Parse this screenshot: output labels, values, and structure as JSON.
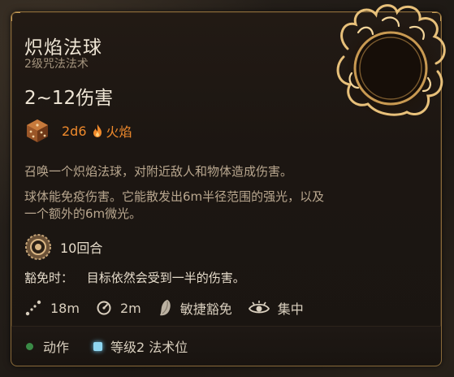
{
  "spell": {
    "title": "炽焰法球",
    "subtitle": "2级咒法法术",
    "damage_total": "2~12伤害",
    "damage_dice": "2d6",
    "damage_type": "火焰",
    "description_1": "召唤一个炽焰法球，对附近敌人和物体造成伤害。",
    "description_2_line1": "球体能免疫伤害。它能散发出6m半径范围的强光，以及",
    "description_2_line2": "一个额外的6m微光。",
    "duration": "10回合",
    "save_label": "豁免时：",
    "save_text": "目标依然会受到一半的伤害。",
    "range": "18m",
    "aoe": "2m",
    "save_type": "敏捷豁免",
    "concentration": "集中"
  },
  "footer": {
    "action_label": "动作",
    "slot_label": "等级2 法术位"
  },
  "colors": {
    "fire": "#f08a2c",
    "border": "#8a6a3a",
    "action_dot": "#3a8a46",
    "slot_square": "#8fd6f0"
  },
  "icons": [
    "flaming-sphere-icon",
    "d6-die-icon",
    "flame-icon",
    "duration-icon",
    "range-icon",
    "aoe-icon",
    "dexterity-save-icon",
    "concentration-icon"
  ]
}
